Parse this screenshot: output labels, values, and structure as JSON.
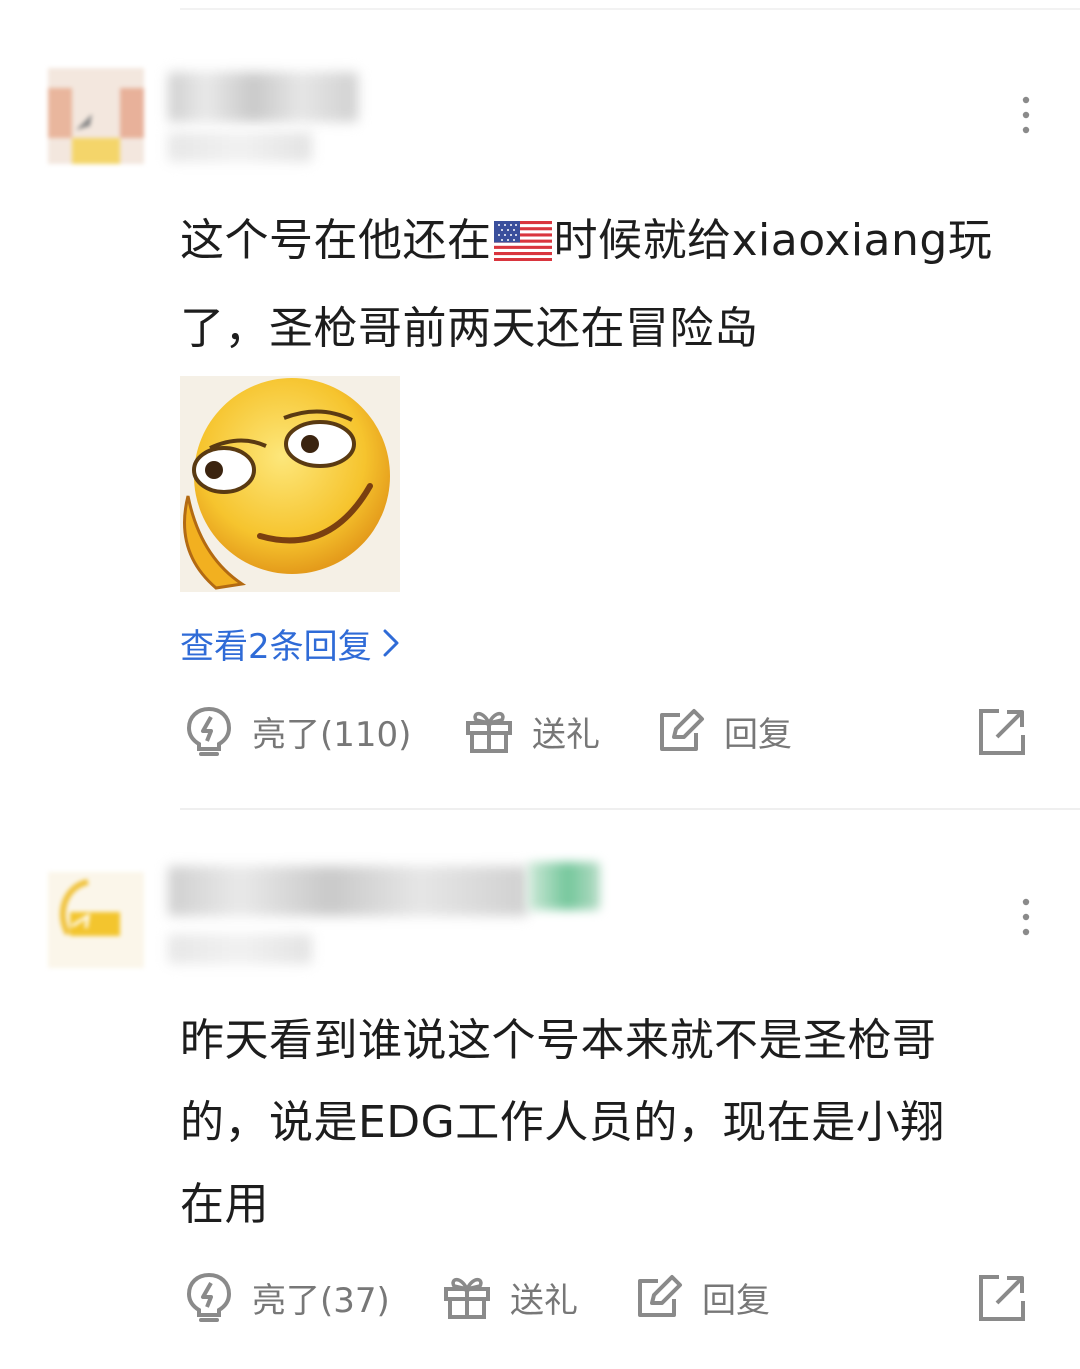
{
  "comments": [
    {
      "text_line1": "这个号在他还在",
      "text_line1_after": "时候就给xiaoxiang玩",
      "text_line2": "了，圣枪哥前两天还在冒险岛",
      "flag_icon": "us-flag-emoji",
      "sticker_icon": "smirking-emoji-sticker",
      "view_replies": "查看2条回复",
      "actions": {
        "like": "亮了(110)",
        "gift": "送礼",
        "reply": "回复"
      }
    },
    {
      "text_lines": [
        "昨天看到谁说这个号本来就不是圣枪哥",
        "的，说是EDG工作人员的，现在是小翔",
        "在用"
      ],
      "actions": {
        "like": "亮了(37)",
        "gift": "送礼",
        "reply": "回复"
      }
    }
  ],
  "colors": {
    "link": "#2f6bd7",
    "action_gray": "#777777",
    "text": "#1d1d1d"
  },
  "icons": [
    "more-vertical-icon",
    "lightning-bulb-icon",
    "gift-icon",
    "edit-reply-icon",
    "share-icon",
    "chevron-right-icon"
  ]
}
